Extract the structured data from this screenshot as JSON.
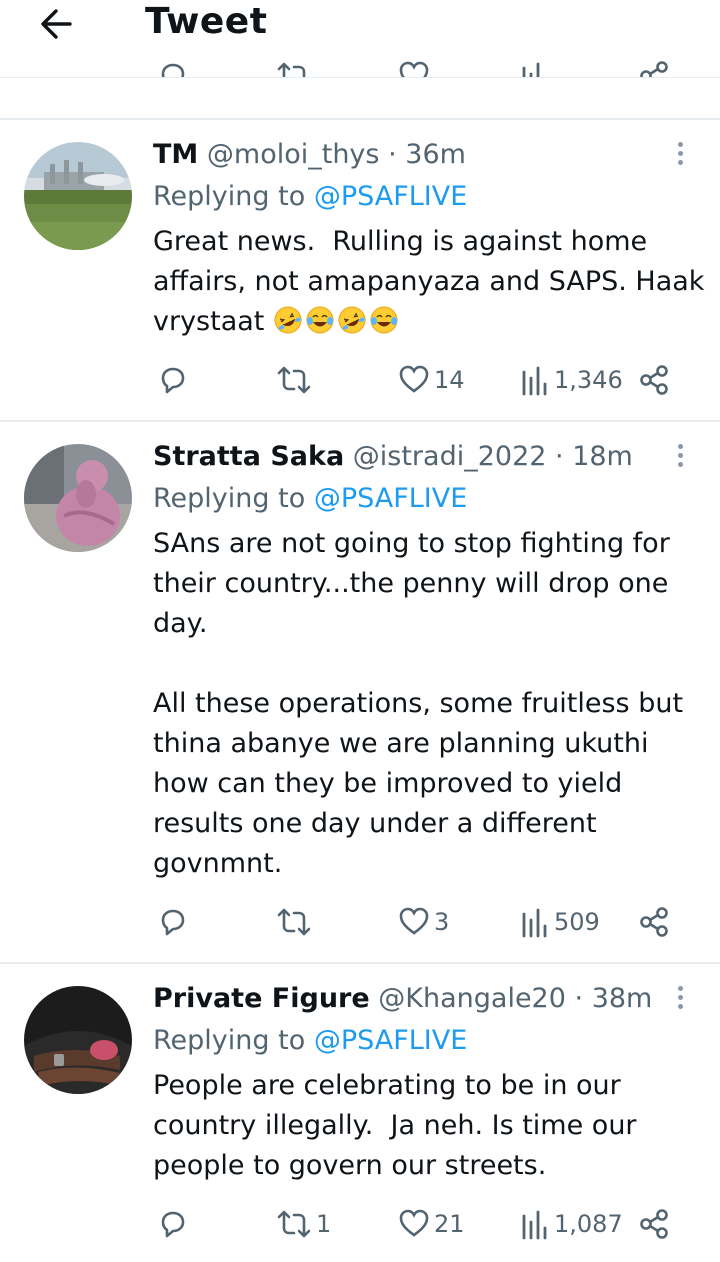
{
  "header": {
    "title": "Tweet"
  },
  "tweets": [
    {
      "name": "TM",
      "handle": "@moloi_thys",
      "sep": "·",
      "time": "36m",
      "reply_prefix": "Replying to",
      "reply_to": "@PSAFLIVE",
      "text": "Great news.  Rulling is against home affairs, not amapanyaza and SAPS. Haak vrystaat",
      "emojis": [
        "rofl-emoji",
        "joy-emoji",
        "rofl-emoji",
        "joy-emoji"
      ],
      "retweets": "",
      "likes": "14",
      "views": "1,346"
    },
    {
      "name": "Stratta Saka",
      "handle": "@istradi_2022",
      "sep": "·",
      "time": "18m",
      "reply_prefix": "Replying to",
      "reply_to": "@PSAFLIVE",
      "text": "SAns are not going to stop fighting for their country...the penny will drop one day.\n\nAll these operations, some fruitless but thina abanye we are planning ukuthi how can they be improved to yield results one day under a different govnmnt.",
      "retweets": "",
      "likes": "3",
      "views": "509"
    },
    {
      "name": "Private Figure",
      "handle": "@Khangale20",
      "sep": "·",
      "time": "38m",
      "reply_prefix": "Replying to",
      "reply_to": "@PSAFLIVE",
      "text": "People are celebrating to be in our country illegally.  Ja neh. Is time our people to govern our streets.",
      "retweets": "1",
      "likes": "21",
      "views": "1,087"
    }
  ],
  "colors": {
    "accent": "#1d9bf0",
    "muted": "#536471",
    "divider": "#e6ecf0"
  }
}
